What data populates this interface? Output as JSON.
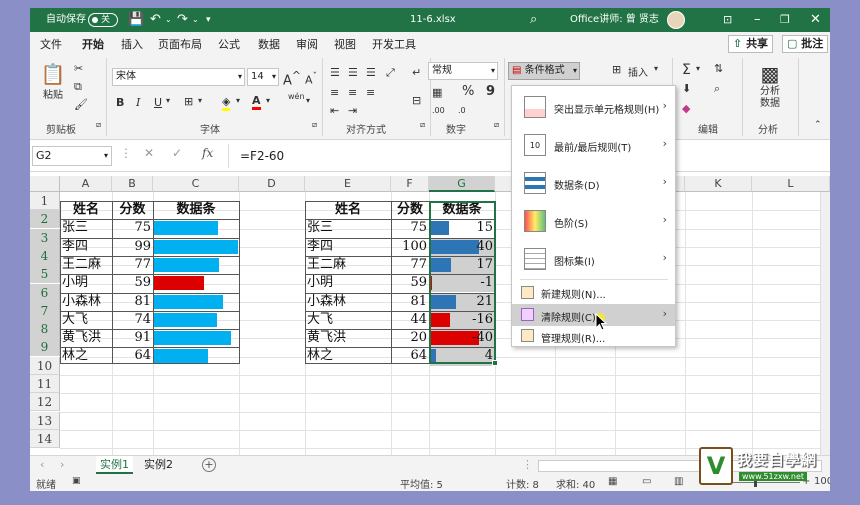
{
  "titlebar": {
    "autosave_label": "自动保存",
    "toggle_state": "关",
    "filename": "11-6.xlsx",
    "user": "Office讲师: 曾 贤志"
  },
  "tabs": [
    "文件",
    "开始",
    "插入",
    "页面布局",
    "公式",
    "数据",
    "审阅",
    "视图",
    "开发工具"
  ],
  "share_label": "共享",
  "comment_label": "批注",
  "ribbon": {
    "paste_label": "粘贴",
    "clipboard_label": "剪贴板",
    "font_name": "宋体",
    "font_size": "14",
    "font_label": "字体",
    "bold": "B",
    "italic": "I",
    "underline": "U",
    "pinyin": "wén",
    "align_label": "对齐方式",
    "number_format": "常规",
    "number_label": "数字",
    "cond_format_label": "条件格式",
    "insert_label": "插入",
    "edit_label": "编辑",
    "analyze_label": "分析数据",
    "analyze_group_label": "分析",
    "a_upper": "A",
    "a_lower": "A",
    "percent": "%",
    "comma": "9",
    "dec_inc": ".00",
    "dec_dec": ".0",
    "sigma": "Σ"
  },
  "formula_bar": {
    "name_box": "G2",
    "formula": "=F2-60",
    "fx": "fx"
  },
  "columns": [
    "A",
    "B",
    "C",
    "D",
    "E",
    "F",
    "G",
    "H",
    "I",
    "J",
    "K",
    "L"
  ],
  "rows": [
    "1",
    "2",
    "3",
    "4",
    "5",
    "6",
    "7",
    "8",
    "9",
    "10",
    "11",
    "12",
    "13",
    "14"
  ],
  "table1": {
    "headers": [
      "姓名",
      "分数",
      "数据条"
    ],
    "rows": [
      {
        "name": "张三",
        "score": "75",
        "bar": 75
      },
      {
        "name": "李四",
        "score": "99",
        "bar": 99
      },
      {
        "name": "王二麻",
        "score": "77",
        "bar": 77
      },
      {
        "name": "小明",
        "score": "59",
        "bar": 59
      },
      {
        "name": "小森林",
        "score": "81",
        "bar": 81
      },
      {
        "name": "大飞",
        "score": "74",
        "bar": 74
      },
      {
        "name": "黄飞洪",
        "score": "91",
        "bar": 91
      },
      {
        "name": "林之",
        "score": "64",
        "bar": 64
      }
    ]
  },
  "table2": {
    "headers": [
      "姓名",
      "分数",
      "数据条"
    ],
    "rows": [
      {
        "name": "张三",
        "score": "75",
        "diff": "15"
      },
      {
        "name": "李四",
        "score": "100",
        "diff": "40"
      },
      {
        "name": "王二麻",
        "score": "77",
        "diff": "17"
      },
      {
        "name": "小明",
        "score": "59",
        "diff": "-1"
      },
      {
        "name": "小森林",
        "score": "81",
        "diff": "21"
      },
      {
        "name": "大飞",
        "score": "44",
        "diff": "-16"
      },
      {
        "name": "黄飞洪",
        "score": "20",
        "diff": "-40"
      },
      {
        "name": "林之",
        "score": "64",
        "diff": "4"
      }
    ]
  },
  "colors": {
    "excel_green": "#217346",
    "bar_cyan": "#00b0f0",
    "bar_blue": "#2e75b6",
    "bar_red": "#dd0000",
    "selection": "#d0d0d0"
  },
  "menu": {
    "items": [
      {
        "label": "突出显示单元格规则(H)",
        "chevron": "›"
      },
      {
        "label": "最前/最后规则(T)",
        "chevron": "›"
      },
      {
        "label": "数据条(D)",
        "chevron": "›"
      },
      {
        "label": "色阶(S)",
        "chevron": "›"
      },
      {
        "label": "图标集(I)",
        "chevron": "›"
      },
      {
        "label": "新建规则(N)...",
        "chevron": ""
      },
      {
        "label": "清除规则(C)",
        "chevron": "›"
      },
      {
        "label": "管理规则(R)...",
        "chevron": ""
      }
    ]
  },
  "sheets": [
    "实例1",
    "实例2"
  ],
  "add_sheet": "+",
  "statusbar": {
    "ready": "就绪",
    "average": "平均值: 5",
    "count": "计数: 8",
    "sum": "求和: 40",
    "zoom": "100%"
  },
  "logo": {
    "text": "我要自學網",
    "url": "www.51zxw.net"
  }
}
